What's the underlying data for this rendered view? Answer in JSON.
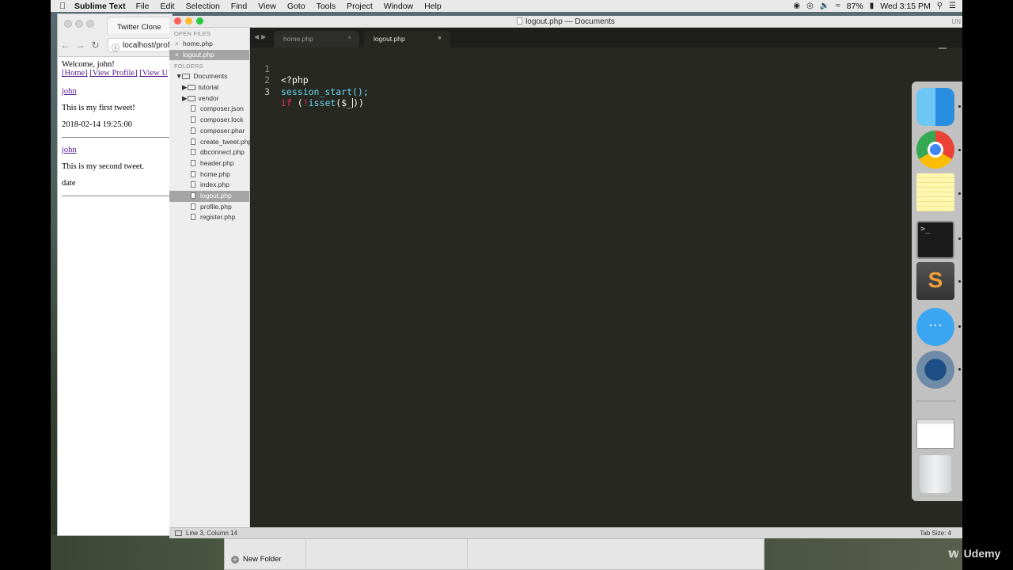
{
  "menubar": {
    "app_name": "Sublime Text",
    "items": [
      "File",
      "Edit",
      "Selection",
      "Find",
      "View",
      "Goto",
      "Tools",
      "Project",
      "Window",
      "Help"
    ],
    "battery": "87%",
    "clock": "Wed 3:15 PM",
    "status_icons": [
      "record-icon",
      "airplay-icon",
      "volume-icon",
      "wifi-icon",
      "battery-icon",
      "search-icon",
      "menu-icon"
    ]
  },
  "browser": {
    "tab_title": "Twitter Clone",
    "url": "localhost/prof",
    "page": {
      "welcome": "Welcome, john!",
      "links": [
        "[Home]",
        "[View Profile]",
        "[View U"
      ],
      "tweets": [
        {
          "user": "john",
          "text": "This is my first tweet!",
          "date": "2018-02-14 19:25:00"
        },
        {
          "user": "john",
          "text": "This is my second tweet.",
          "date": "date"
        }
      ]
    }
  },
  "sublime": {
    "window_title": "logout.php — Documents",
    "title_right": "UN",
    "sidebar": {
      "open_files_header": "OPEN FILES",
      "open_files": [
        {
          "name": "home.php",
          "selected": false
        },
        {
          "name": "logout.php",
          "selected": true
        }
      ],
      "folders_header": "FOLDERS",
      "root_folder": "Documents",
      "subfolders": [
        "tutorial",
        "vendor"
      ],
      "files": [
        {
          "name": "composer.json",
          "selected": false
        },
        {
          "name": "composer.lock",
          "selected": false
        },
        {
          "name": "composer.phar",
          "selected": false
        },
        {
          "name": "create_tweet.php",
          "selected": false
        },
        {
          "name": "dbconnect.php",
          "selected": false
        },
        {
          "name": "header.php",
          "selected": false
        },
        {
          "name": "home.php",
          "selected": false
        },
        {
          "name": "index.php",
          "selected": false
        },
        {
          "name": "logout.php",
          "selected": true
        },
        {
          "name": "profile.php",
          "selected": false
        },
        {
          "name": "register.php",
          "selected": false
        }
      ]
    },
    "tabs": [
      {
        "label": "home.php",
        "active": false,
        "marker": "×"
      },
      {
        "label": "logout.php",
        "active": true,
        "marker": "●"
      }
    ],
    "code": {
      "line_numbers": [
        "1",
        "2",
        "3"
      ],
      "line1": "<?php",
      "line2": "session_start();",
      "line3_kw": "if",
      "line3_paren": "(",
      "line3_not": "!",
      "line3_fn": "isset",
      "line3_rest": "($_",
      "line3_end": "))"
    },
    "status": {
      "position": "Line 3, Column 14",
      "tab_size": "Tab Size: 4"
    }
  },
  "finder": {
    "new_folder_label": "New Folder"
  },
  "dock": {
    "items": [
      "finder-icon",
      "chrome-icon",
      "notes-icon",
      "terminal-icon",
      "sublime-text-icon",
      "messages-icon",
      "quicktime-icon",
      "browser-window-thumbnail-icon",
      "trash-icon"
    ]
  },
  "watermark": {
    "text": "Udemy"
  },
  "colors": {
    "editor_bg": "#272822",
    "keyword": "#f92672",
    "function": "#66d9ef",
    "plain": "#f8f8f2",
    "line_number": "#8f908a"
  }
}
